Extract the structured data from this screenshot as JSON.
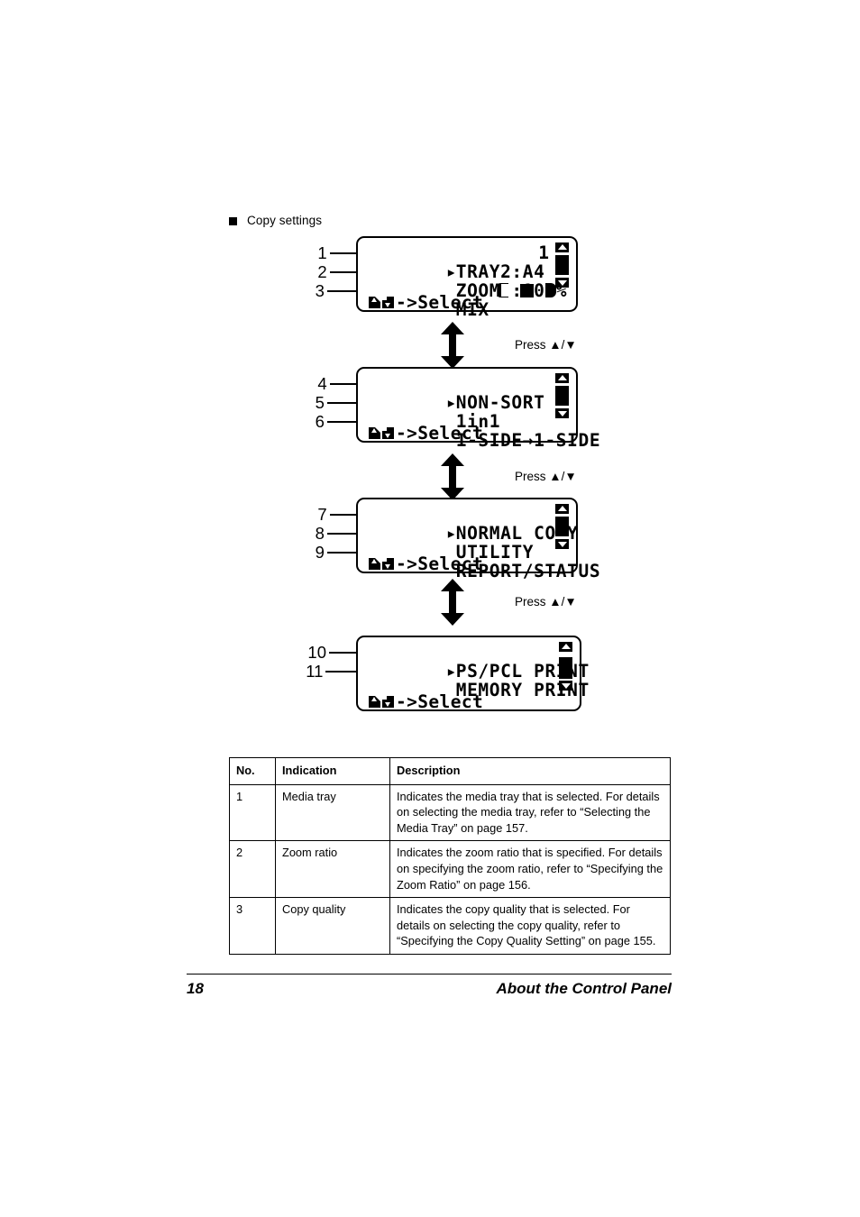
{
  "section": {
    "bullet_icon": "filled-square-bullet",
    "heading": "Copy settings"
  },
  "panels": [
    {
      "id": "copy-settings-screen",
      "rows": [
        {
          "marker": "▸",
          "text": "TRAY2:A4",
          "callout": "1"
        },
        {
          "marker": "",
          "text": "ZOOM :100%",
          "callout": "2"
        },
        {
          "marker": "",
          "text": "MIX",
          "callout": "3"
        }
      ],
      "copies_value": "1",
      "quality_indicator": {
        "left_icon": "contrast-light-icon",
        "center_icon": "filled-square-icon",
        "right_icon": "contrast-dark-icon"
      },
      "select_hint": "->Select",
      "key_icons": [
        "up-key-icon",
        "down-key-icon"
      ],
      "scrollbar": {
        "up_icon": "scroll-up-arrow-icon",
        "down_icon": "scroll-down-arrow-icon",
        "thumb_position": "middle"
      }
    },
    {
      "id": "finishing-settings-screen",
      "rows": [
        {
          "marker": "▸",
          "text": "NON-SORT",
          "callout": "4"
        },
        {
          "marker": "",
          "text": "1in1",
          "callout": "5"
        },
        {
          "marker": "",
          "text": "1-SIDE→1-SIDE",
          "callout": "6"
        }
      ],
      "copies_value": "",
      "select_hint": "->Select",
      "key_icons": [
        "up-key-icon",
        "down-key-icon"
      ],
      "scrollbar": {
        "up_icon": "scroll-up-arrow-icon",
        "down_icon": "scroll-down-arrow-icon",
        "thumb_position": "middle"
      }
    },
    {
      "id": "main-menu-screen",
      "rows": [
        {
          "marker": "▸",
          "text": "NORMAL COPY",
          "callout": "7"
        },
        {
          "marker": "",
          "text": "UTILITY",
          "callout": "8"
        },
        {
          "marker": "",
          "text": "REPORT/STATUS",
          "callout": "9"
        }
      ],
      "copies_value": "",
      "select_hint": "->Select",
      "key_icons": [
        "up-key-icon",
        "down-key-icon"
      ],
      "scrollbar": {
        "up_icon": "scroll-up-arrow-icon",
        "down_icon": "scroll-down-arrow-icon",
        "thumb_position": "middle"
      }
    },
    {
      "id": "print-menu-screen",
      "rows": [
        {
          "marker": "▸",
          "text": "PS/PCL PRINT",
          "callout": "10"
        },
        {
          "marker": "",
          "text": "MEMORY PRINT",
          "callout": "11"
        }
      ],
      "copies_value": "",
      "select_hint": "->Select",
      "key_icons": [
        "up-key-icon",
        "down-key-icon"
      ],
      "scrollbar": {
        "up_icon": "scroll-up-arrow-icon",
        "down_icon": "scroll-down-arrow-icon",
        "thumb_position": "lower"
      }
    }
  ],
  "transitions": [
    {
      "label": "Press ▲/▼"
    },
    {
      "label": "Press ▲/▼"
    },
    {
      "label": "Press ▲/▼"
    }
  ],
  "table": {
    "headers": [
      "No.",
      "Indication",
      "Description"
    ],
    "rows": [
      {
        "no": "1",
        "indication": "Media tray",
        "description": "Indicates the media tray that is selected. For details on selecting the media tray, refer to “Selecting the Media Tray” on page 157."
      },
      {
        "no": "2",
        "indication": "Zoom ratio",
        "description": "Indicates the zoom ratio that is specified. For details on specifying the zoom ratio, refer to “Specifying the Zoom Ratio” on page 156."
      },
      {
        "no": "3",
        "indication": "Copy quality",
        "description": "Indicates the copy quality that is selected. For details on selecting the copy quality, refer to “Specifying the Copy Quality Setting” on page 155."
      }
    ]
  },
  "footer": {
    "page_number": "18",
    "title": "About the Control Panel"
  }
}
